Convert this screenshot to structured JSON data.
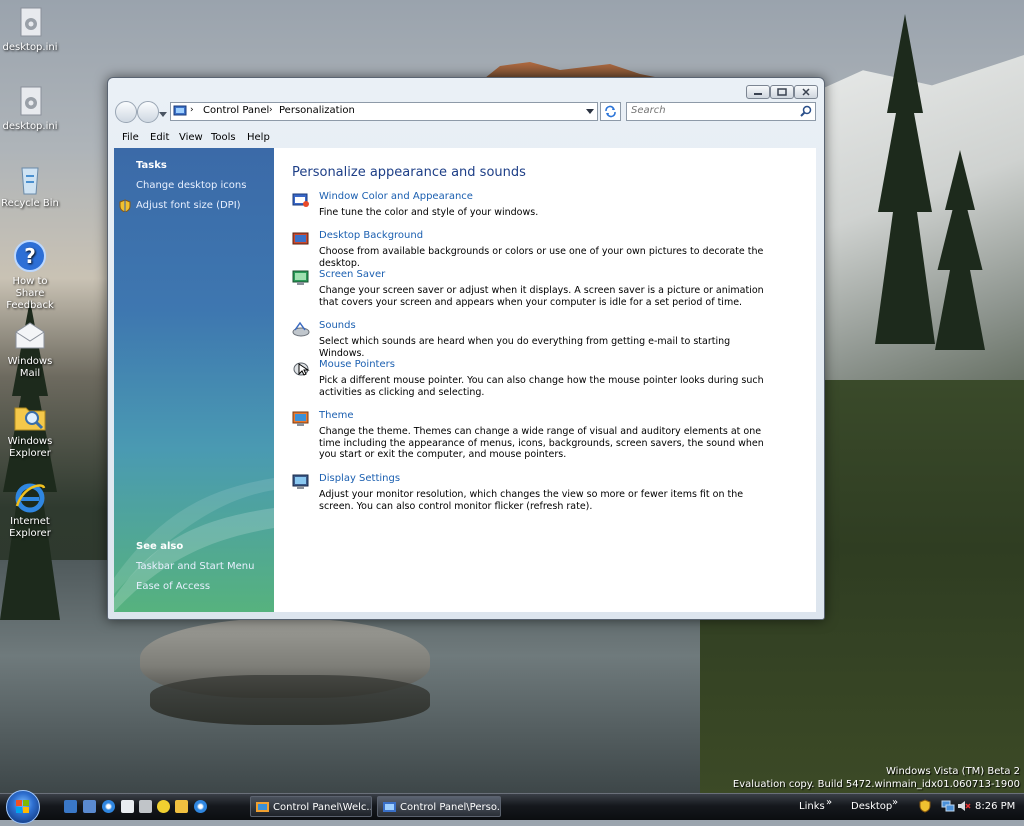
{
  "desktop": {
    "icons": [
      {
        "name": "desktop.ini",
        "icon": "file-gear-icon"
      },
      {
        "name": "desktop.ini",
        "icon": "file-gear-icon"
      },
      {
        "name": "Recycle Bin",
        "icon": "recycle-bin-icon"
      },
      {
        "name": "How to Share Feedback",
        "icon": "help-icon"
      },
      {
        "name": "Windows Mail",
        "icon": "mail-icon"
      },
      {
        "name": "Windows Explorer",
        "icon": "folder-search-icon"
      },
      {
        "name": "Internet Explorer",
        "icon": "ie-icon"
      }
    ],
    "watermark": {
      "line1": "Windows Vista (TM) Beta 2",
      "line2": "Evaluation copy. Build 5472.winmain_idx01.060713-1900"
    }
  },
  "window": {
    "address": {
      "part1": "Control Panel",
      "part2": "Personalization"
    },
    "search": {
      "placeholder": "Search"
    },
    "menu": [
      "File",
      "Edit",
      "View",
      "Tools",
      "Help"
    ],
    "left_panel": {
      "tasks_heading": "Tasks",
      "tasks": [
        "Change desktop icons",
        "Adjust font size (DPI)"
      ],
      "see_also_heading": "See also",
      "see_also": [
        "Taskbar and Start Menu",
        "Ease of Access"
      ]
    },
    "heading": "Personalize appearance and sounds",
    "items": [
      {
        "title": "Window Color and Appearance",
        "desc": "Fine tune the color and style of your windows.",
        "icon": "window-color-icon"
      },
      {
        "title": "Desktop Background",
        "desc": "Choose from available backgrounds or colors or use one of your own pictures to decorate the desktop.",
        "icon": "desktop-background-icon"
      },
      {
        "title": "Screen Saver",
        "desc": "Change your screen saver or adjust when it displays. A screen saver is a picture or animation that covers your screen and appears when your computer is idle for a set period of time.",
        "icon": "screen-saver-icon"
      },
      {
        "title": "Sounds",
        "desc": "Select which sounds are heard when you do everything from getting e-mail to starting Windows.",
        "icon": "sounds-icon"
      },
      {
        "title": "Mouse Pointers",
        "desc": "Pick a different mouse pointer. You can also change how the mouse pointer looks during such activities as clicking and selecting.",
        "icon": "mouse-pointer-icon"
      },
      {
        "title": "Theme",
        "desc": "Change the theme. Themes can change a wide range of visual and auditory elements at one time including the appearance of menus, icons, backgrounds, screen savers, the sound when you start or exit the computer, and mouse pointers.",
        "icon": "theme-icon"
      },
      {
        "title": "Display Settings",
        "desc": "Adjust your monitor resolution, which changes the view so more or fewer items fit on the screen. You can also control monitor flicker (refresh rate).",
        "icon": "display-settings-icon"
      }
    ]
  },
  "taskbar": {
    "buttons": [
      "Control Panel\\Welc...",
      "Control Panel\\Perso..."
    ],
    "links": "Links",
    "links_chevron": "»",
    "desktop": "Desktop",
    "desktop_chevron": "»",
    "clock": "8:26 PM"
  },
  "colors": {
    "link": "#1b5fb0",
    "heading": "#1e3f87",
    "left_panel_top": "#3b6aa8",
    "left_panel_bottom": "#56b27e"
  }
}
